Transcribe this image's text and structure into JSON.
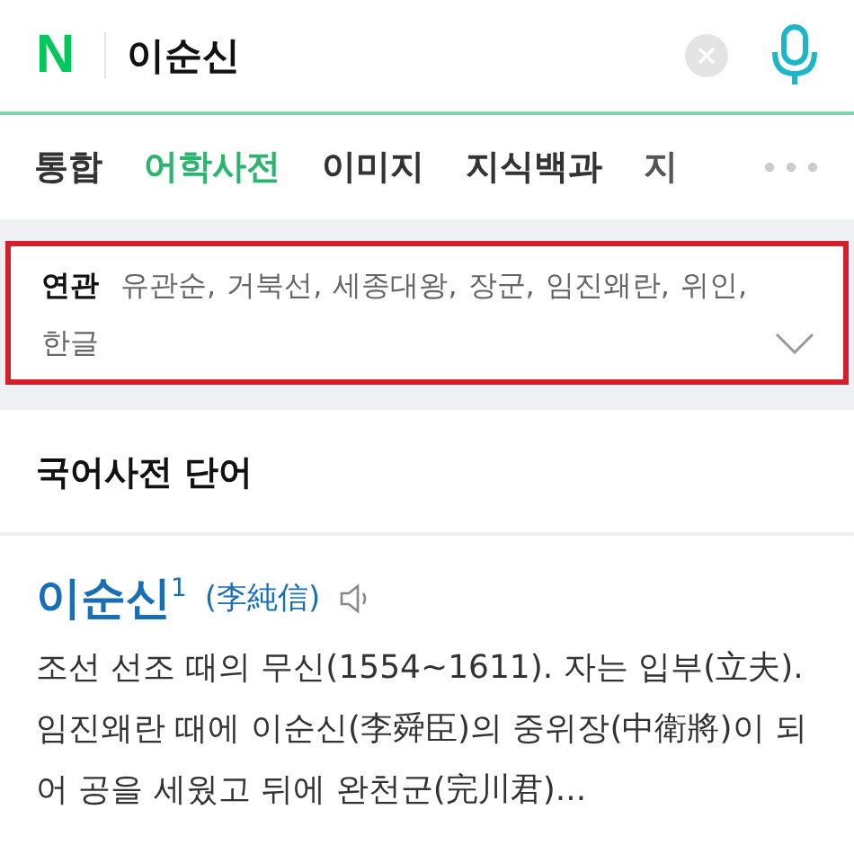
{
  "search": {
    "logo": "N",
    "query": "이순신"
  },
  "tabs": [
    {
      "label": "통합",
      "selected": false
    },
    {
      "label": "어학사전",
      "selected": true
    },
    {
      "label": "이미지",
      "selected": false
    },
    {
      "label": "지식백과",
      "selected": false
    },
    {
      "label": "지",
      "selected": false
    }
  ],
  "related": {
    "label": "연관",
    "items": [
      "유관순,",
      "거북선,",
      "세종대왕,",
      "장군,",
      "임진왜란,",
      "위인,",
      "한글"
    ],
    "expanded": false
  },
  "section": {
    "title": "국어사전 단어"
  },
  "entry": {
    "headword": "이순신$^{1}$",
    "hanja": "(李純信)",
    "definition": "조선 선조 때의 무신(1554~1611). 자는 입부(立夫). 임진왜란 때에 이순신(李舜臣)의 중위장(中衛將)이 되어 공을 세웠고 뒤에 완천군(完川君)..."
  }
}
